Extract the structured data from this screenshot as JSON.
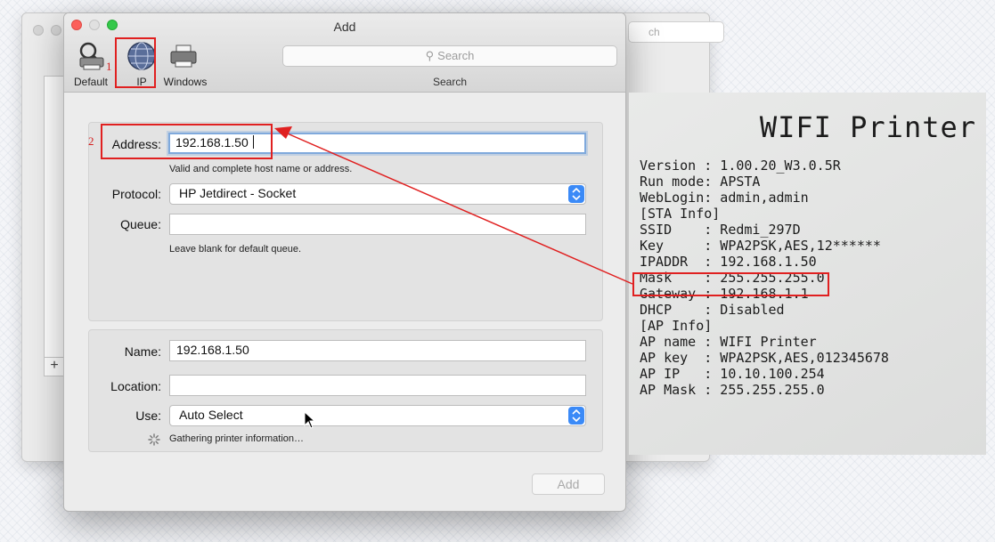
{
  "background_window": {
    "search_placeholder": "ch",
    "add_symbol": "+"
  },
  "dialog": {
    "title": "Add",
    "toolbar": {
      "default_label": "Default",
      "ip_label": "IP",
      "windows_label": "Windows",
      "search_placeholder": "Search",
      "search_caption": "Search"
    },
    "address": {
      "label": "Address:",
      "value": "192.168.1.50",
      "hint": "Valid and complete host name or address."
    },
    "protocol": {
      "label": "Protocol:",
      "value": "HP Jetdirect - Socket"
    },
    "queue": {
      "label": "Queue:",
      "value": "",
      "hint": "Leave blank for default queue."
    },
    "name": {
      "label": "Name:",
      "value": "192.168.1.50"
    },
    "location": {
      "label": "Location:",
      "value": ""
    },
    "use": {
      "label": "Use:",
      "value": "Auto Select"
    },
    "status": "Gathering printer information…",
    "add_button": "Add"
  },
  "annotations": {
    "step1": "1",
    "step2": "2",
    "color": "#e02020"
  },
  "receipt": {
    "title": "WIFI Printer",
    "lines": [
      "Version : 1.00.20_W3.0.5R",
      "Run mode: APSTA",
      "WebLogin: admin,admin",
      "[STA Info]",
      "SSID    : Redmi_297D",
      "Key     : WPA2PSK,AES,12******",
      "IPADDR  : 192.168.1.50",
      "Mask    : 255.255.255.0",
      "Gateway : 192.168.1.1",
      "DHCP    : Disabled",
      "[AP Info]",
      "AP name : WIFI Printer",
      "AP key  : WPA2PSK,AES,012345678",
      "AP IP   : 10.10.100.254",
      "AP Mask : 255.255.255.0"
    ]
  }
}
